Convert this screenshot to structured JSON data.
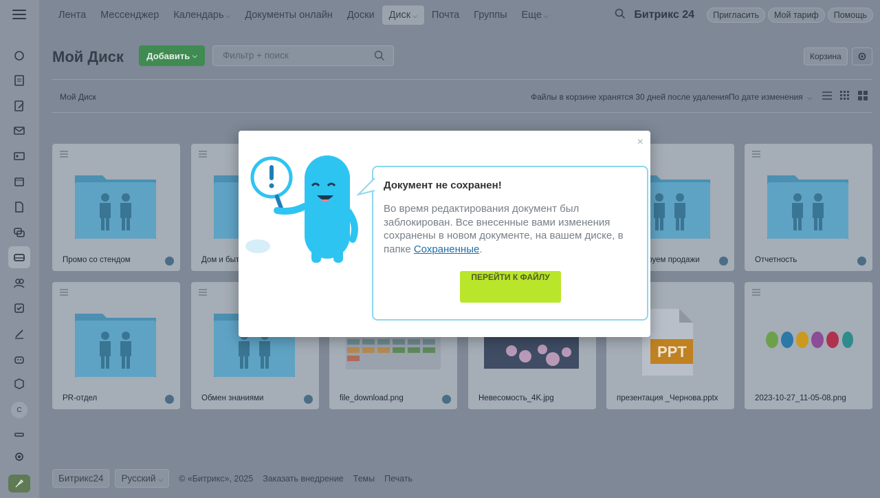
{
  "nav": {
    "items": [
      "Лента",
      "Мессенджер",
      "Календарь",
      "Документы онлайн",
      "Доски",
      "Диск",
      "Почта",
      "Группы",
      "Еще"
    ],
    "active_index": 5,
    "brand": "Битрикс 24",
    "invite": "Пригласить",
    "tariff": "Мой тариф",
    "help": "Помощь"
  },
  "page": {
    "title": "Мой Диск",
    "add_label": "Добавить",
    "search_placeholder": "Фильтр + поиск",
    "trash_label": "Корзина",
    "breadcrumb": "Мой Диск",
    "trash_note": "Файлы в корзине хранятся 30 дней после удаления",
    "sort_label": "По дате изменения"
  },
  "cards": [
    {
      "title": "Промо со стендом",
      "kind": "shared-folder"
    },
    {
      "title": "Дом и быт",
      "kind": "shared-folder"
    },
    {
      "title": "",
      "kind": "hidden"
    },
    {
      "title": "",
      "kind": "hidden"
    },
    {
      "title": "Анализируем продажи",
      "kind": "shared-folder"
    },
    {
      "title": "Отчетность",
      "kind": "shared-folder"
    },
    {
      "title": "PR-отдел",
      "kind": "shared-folder"
    },
    {
      "title": "Обмен знаниями",
      "kind": "shared-folder"
    },
    {
      "title": "file_download.png",
      "kind": "image"
    },
    {
      "title": "Невесомость_4K.jpg",
      "kind": "photo"
    },
    {
      "title": "презентация _Чернова.pptx",
      "kind": "pptx"
    },
    {
      "title": "2023-10-27_11-05-08.png",
      "kind": "balloons"
    }
  ],
  "pptx_badge": "PPT",
  "modal": {
    "title": "Документ не сохранен!",
    "body": "Во время редактирования документ был заблокирован. Все внесенные вами изменения сохранены в новом документе, на вашем диске, в папке ",
    "link": "Сохраненные",
    "period": ".",
    "button": "ПЕРЕЙТИ К ФАЙЛУ",
    "close": "×"
  },
  "footer": {
    "brand": "Битрикс24",
    "lang": "Русский",
    "copyright": "© «Битрикс», 2025",
    "order": "Заказать внедрение",
    "themes": "Темы",
    "print": "Печать"
  },
  "sidebar_letter": "С",
  "colors": {
    "accent_green": "#b9e62a",
    "folder_blue": "#1ab3e0",
    "bubble_border": "#8dd6ee"
  }
}
